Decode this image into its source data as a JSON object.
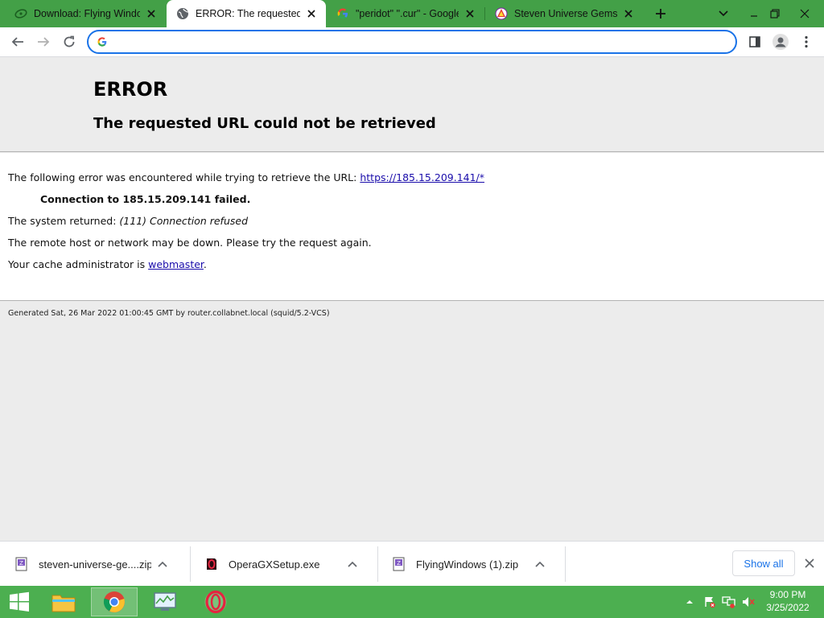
{
  "tabs": [
    {
      "title": "Download: Flying Windows",
      "favicon": "firefox-swirl-icon",
      "active": false
    },
    {
      "title": "ERROR: The requested URL",
      "favicon": "globe-icon",
      "active": true
    },
    {
      "title": "\"peridot\" \".cur\" - Google Search",
      "favicon": "google-g-icon",
      "active": false
    },
    {
      "title": "Steven Universe Gems Cursors",
      "favicon": "site-icon",
      "active": false
    }
  ],
  "omnibox": {
    "value": "",
    "placeholder": ""
  },
  "page": {
    "h1": "ERROR",
    "h2": "The requested URL could not be retrieved",
    "intro_text": "The following error was encountered while trying to retrieve the URL: ",
    "url_link": "https://185.15.209.141/*",
    "connection_failed": "Connection to 185.15.209.141 failed.",
    "system_returned_label": "The system returned: ",
    "system_returned_value": "(111) Connection refused",
    "remote_host_text": "The remote host or network may be down. Please try the request again.",
    "cache_admin_prefix": "Your cache administrator is ",
    "cache_admin_link": "webmaster",
    "cache_admin_suffix": ".",
    "generated_note": "Generated Sat, 26 Mar 2022 01:00:45 GMT by router.collabnet.local (squid/5.2-VCS)"
  },
  "downloads": {
    "items": [
      {
        "name": "steven-universe-ge....zip",
        "icon": "zip-file-icon"
      },
      {
        "name": "OperaGXSetup.exe",
        "icon": "opera-gx-icon"
      },
      {
        "name": "FlyingWindows (1).zip",
        "icon": "zip-file-icon"
      }
    ],
    "show_all_label": "Show all"
  },
  "taskbar": {
    "time": "9:00 PM",
    "date": "3/25/2022"
  },
  "colors": {
    "tabstrip": "#43a047",
    "taskbar": "#4caf50",
    "accent": "#1a73e8",
    "link": "#1a0dab"
  }
}
